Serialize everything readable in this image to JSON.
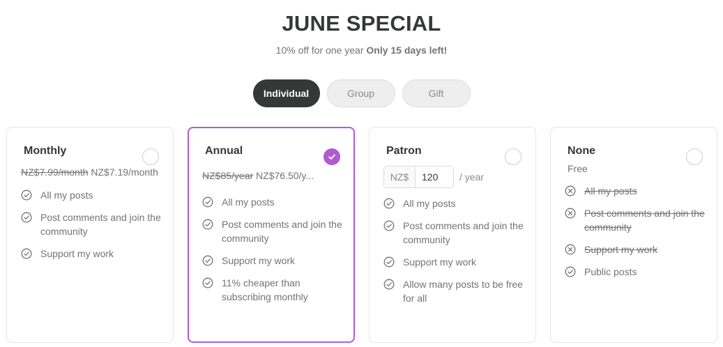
{
  "header": {
    "title": "JUNE SPECIAL",
    "subtitle": "10% off for one year",
    "subtitle_bold": "Only 15 days left!"
  },
  "tabs": [
    {
      "label": "Individual",
      "active": true
    },
    {
      "label": "Group",
      "active": false
    },
    {
      "label": "Gift",
      "active": false
    }
  ],
  "plans": [
    {
      "title": "Monthly",
      "selected": false,
      "price_old": "NZ$7.99/month",
      "price_new": "NZ$7.19/month",
      "features": [
        "All my posts",
        "Post comments and join the community",
        "Support my work"
      ]
    },
    {
      "title": "Annual",
      "selected": true,
      "price_old": "NZ$85/year",
      "price_new": "NZ$76.50/y...",
      "features": [
        "All my posts",
        "Post comments and join the community",
        "Support my work",
        "11% cheaper than subscribing monthly"
      ]
    },
    {
      "title": "Patron",
      "selected": false,
      "currency": "NZ$",
      "amount": "120",
      "period": "/ year",
      "features": [
        "All my posts",
        "Post comments and join the community",
        "Support my work",
        "Allow many posts to be free for all"
      ]
    },
    {
      "title": "None",
      "selected": false,
      "price_label": "Free",
      "excluded_features": [
        "All my posts",
        "Post comments and join the community",
        "Support my work"
      ],
      "features": [
        "Public posts"
      ]
    }
  ],
  "colors": {
    "accent": "#b15ad4",
    "dark": "#363737",
    "muted": "#737373"
  },
  "icons": {
    "included": "check-circle-icon",
    "excluded": "x-circle-icon",
    "selected": "checkmark-icon"
  }
}
